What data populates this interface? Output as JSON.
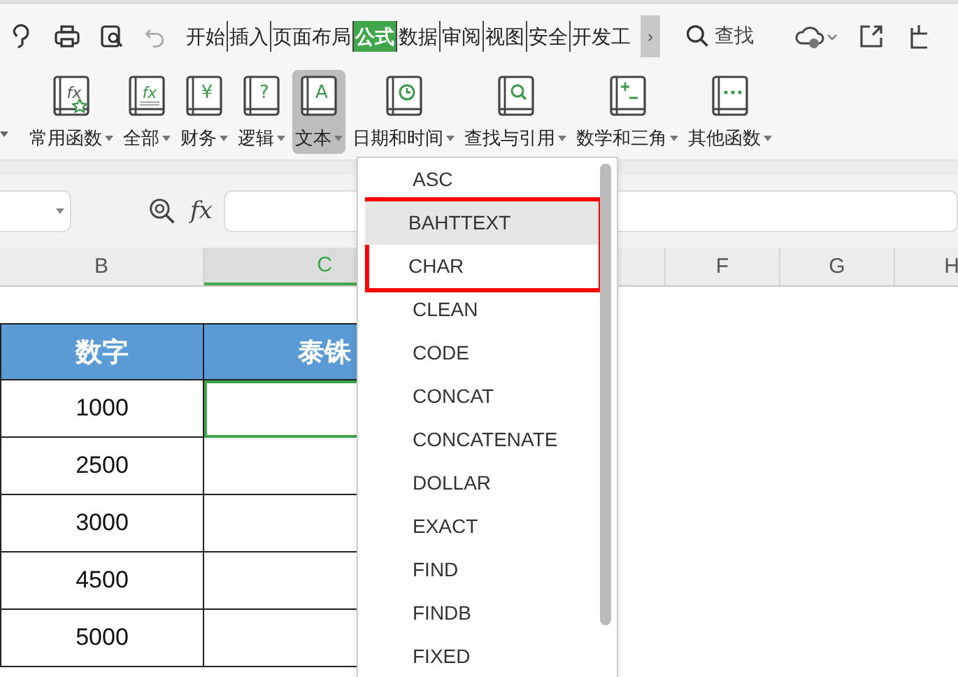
{
  "toolbar": {
    "tabs": [
      {
        "label": "开始",
        "selected": false
      },
      {
        "label": "插入",
        "selected": false
      },
      {
        "label": "页面布局",
        "selected": false
      },
      {
        "label": "公式",
        "selected": true
      },
      {
        "label": "数据",
        "selected": false
      },
      {
        "label": "审阅",
        "selected": false
      },
      {
        "label": "视图",
        "selected": false
      },
      {
        "label": "安全",
        "selected": false
      },
      {
        "label": "开发工",
        "selected": false
      }
    ],
    "more": "›",
    "search": "查找"
  },
  "ribbon": {
    "buttons": [
      {
        "label": "常用函数",
        "kind": "fx-star",
        "glyph": "fx",
        "pressed": false
      },
      {
        "label": "全部",
        "kind": "fx",
        "glyph": "fx",
        "pressed": false
      },
      {
        "label": "财务",
        "kind": "glyph",
        "glyph": "¥",
        "pressed": false
      },
      {
        "label": "逻辑",
        "kind": "glyph",
        "glyph": "?",
        "pressed": false
      },
      {
        "label": "文本",
        "kind": "glyph",
        "glyph": "A",
        "pressed": true
      },
      {
        "label": "日期和时间",
        "kind": "clock",
        "pressed": false
      },
      {
        "label": "查找与引用",
        "kind": "search",
        "pressed": false
      },
      {
        "label": "数学和三角",
        "kind": "math",
        "pressed": false
      },
      {
        "label": "其他函数",
        "kind": "dots",
        "pressed": false
      }
    ]
  },
  "formula_bar": {
    "function_label": "fx"
  },
  "columns_left": [
    {
      "label": "B",
      "selected": false
    },
    {
      "label": "C",
      "selected": true
    }
  ],
  "columns_right": [
    {
      "label": "F",
      "selected": false
    },
    {
      "label": "G",
      "selected": false
    },
    {
      "label": "H",
      "selected": false
    }
  ],
  "table": {
    "headers": [
      "数字",
      "泰铢"
    ],
    "rows": [
      {
        "number": "1000",
        "result_selected": true
      },
      {
        "number": "2500",
        "result_selected": false
      },
      {
        "number": "3000",
        "result_selected": false
      },
      {
        "number": "4500",
        "result_selected": false
      },
      {
        "number": "5000",
        "result_selected": false
      }
    ]
  },
  "dropdown": {
    "items": [
      {
        "label": "ASC",
        "hovered": false,
        "highlighted": false
      },
      {
        "label": "BAHTTEXT",
        "hovered": true,
        "highlighted": true
      },
      {
        "label": "CHAR",
        "hovered": false,
        "highlighted": true
      },
      {
        "label": "CLEAN",
        "hovered": false,
        "highlighted": false
      },
      {
        "label": "CODE",
        "hovered": false,
        "highlighted": false
      },
      {
        "label": "CONCAT",
        "hovered": false,
        "highlighted": false
      },
      {
        "label": "CONCATENATE",
        "hovered": false,
        "highlighted": false
      },
      {
        "label": "DOLLAR",
        "hovered": false,
        "highlighted": false
      },
      {
        "label": "EXACT",
        "hovered": false,
        "highlighted": false
      },
      {
        "label": "FIND",
        "hovered": false,
        "highlighted": false
      },
      {
        "label": "FINDB",
        "hovered": false,
        "highlighted": false
      },
      {
        "label": "FIXED",
        "hovered": false,
        "highlighted": false
      }
    ]
  }
}
